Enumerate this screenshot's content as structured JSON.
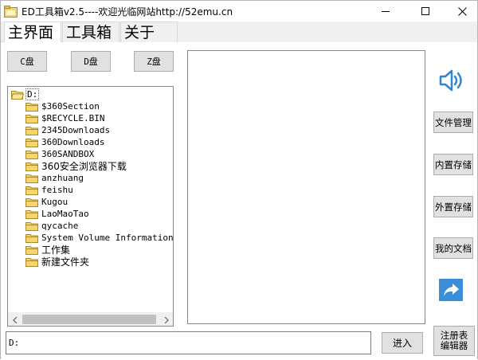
{
  "window": {
    "title": "ED工具箱v2.5----欢迎光临网站http://52emu.cn",
    "minimize_glyph": "—",
    "maximize_glyph": "☐",
    "close_glyph": "✕"
  },
  "tabs": [
    {
      "label": "主界面",
      "active": true
    },
    {
      "label": "工具箱",
      "active": false
    },
    {
      "label": "关于",
      "active": false
    }
  ],
  "drives": {
    "c": "C盘",
    "d": "D盘",
    "z": "Z盘"
  },
  "tree": {
    "root": "D:",
    "items": [
      "$360Section",
      "$RECYCLE.BIN",
      "2345Downloads",
      "360Downloads",
      "360SANDBOX",
      "360安全浏览器下载",
      "anzhuang",
      "feishu",
      "Kugou",
      "LaoMaoTao",
      "qycache",
      "System Volume Information",
      "工作集",
      "新建文件夹"
    ]
  },
  "side_buttons": {
    "file_manager": "文件管理",
    "internal_storage": "内置存储",
    "external_storage": "外置存储",
    "my_documents": "我的文档",
    "registry_editor": "注册表编辑器"
  },
  "path": {
    "value": "D:",
    "enter_label": "进入"
  },
  "colors": {
    "accent_blue": "#3b8fd8",
    "speaker_blue": "#2f86d4",
    "folder_yellow": "#f5d66e"
  }
}
